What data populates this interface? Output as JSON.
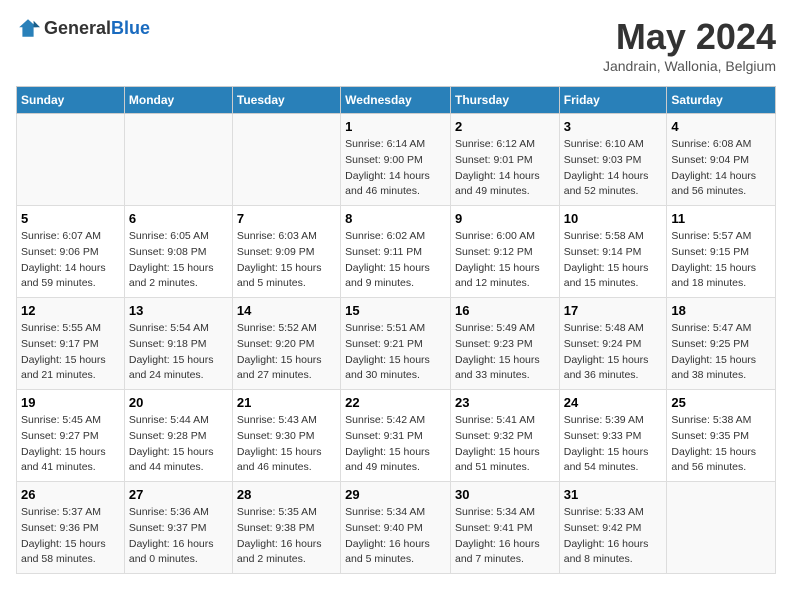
{
  "header": {
    "logo_general": "General",
    "logo_blue": "Blue",
    "month_title": "May 2024",
    "location": "Jandrain, Wallonia, Belgium"
  },
  "weekdays": [
    "Sunday",
    "Monday",
    "Tuesday",
    "Wednesday",
    "Thursday",
    "Friday",
    "Saturday"
  ],
  "weeks": [
    [
      {
        "day": "",
        "info": ""
      },
      {
        "day": "",
        "info": ""
      },
      {
        "day": "",
        "info": ""
      },
      {
        "day": "1",
        "info": "Sunrise: 6:14 AM\nSunset: 9:00 PM\nDaylight: 14 hours\nand 46 minutes."
      },
      {
        "day": "2",
        "info": "Sunrise: 6:12 AM\nSunset: 9:01 PM\nDaylight: 14 hours\nand 49 minutes."
      },
      {
        "day": "3",
        "info": "Sunrise: 6:10 AM\nSunset: 9:03 PM\nDaylight: 14 hours\nand 52 minutes."
      },
      {
        "day": "4",
        "info": "Sunrise: 6:08 AM\nSunset: 9:04 PM\nDaylight: 14 hours\nand 56 minutes."
      }
    ],
    [
      {
        "day": "5",
        "info": "Sunrise: 6:07 AM\nSunset: 9:06 PM\nDaylight: 14 hours\nand 59 minutes."
      },
      {
        "day": "6",
        "info": "Sunrise: 6:05 AM\nSunset: 9:08 PM\nDaylight: 15 hours\nand 2 minutes."
      },
      {
        "day": "7",
        "info": "Sunrise: 6:03 AM\nSunset: 9:09 PM\nDaylight: 15 hours\nand 5 minutes."
      },
      {
        "day": "8",
        "info": "Sunrise: 6:02 AM\nSunset: 9:11 PM\nDaylight: 15 hours\nand 9 minutes."
      },
      {
        "day": "9",
        "info": "Sunrise: 6:00 AM\nSunset: 9:12 PM\nDaylight: 15 hours\nand 12 minutes."
      },
      {
        "day": "10",
        "info": "Sunrise: 5:58 AM\nSunset: 9:14 PM\nDaylight: 15 hours\nand 15 minutes."
      },
      {
        "day": "11",
        "info": "Sunrise: 5:57 AM\nSunset: 9:15 PM\nDaylight: 15 hours\nand 18 minutes."
      }
    ],
    [
      {
        "day": "12",
        "info": "Sunrise: 5:55 AM\nSunset: 9:17 PM\nDaylight: 15 hours\nand 21 minutes."
      },
      {
        "day": "13",
        "info": "Sunrise: 5:54 AM\nSunset: 9:18 PM\nDaylight: 15 hours\nand 24 minutes."
      },
      {
        "day": "14",
        "info": "Sunrise: 5:52 AM\nSunset: 9:20 PM\nDaylight: 15 hours\nand 27 minutes."
      },
      {
        "day": "15",
        "info": "Sunrise: 5:51 AM\nSunset: 9:21 PM\nDaylight: 15 hours\nand 30 minutes."
      },
      {
        "day": "16",
        "info": "Sunrise: 5:49 AM\nSunset: 9:23 PM\nDaylight: 15 hours\nand 33 minutes."
      },
      {
        "day": "17",
        "info": "Sunrise: 5:48 AM\nSunset: 9:24 PM\nDaylight: 15 hours\nand 36 minutes."
      },
      {
        "day": "18",
        "info": "Sunrise: 5:47 AM\nSunset: 9:25 PM\nDaylight: 15 hours\nand 38 minutes."
      }
    ],
    [
      {
        "day": "19",
        "info": "Sunrise: 5:45 AM\nSunset: 9:27 PM\nDaylight: 15 hours\nand 41 minutes."
      },
      {
        "day": "20",
        "info": "Sunrise: 5:44 AM\nSunset: 9:28 PM\nDaylight: 15 hours\nand 44 minutes."
      },
      {
        "day": "21",
        "info": "Sunrise: 5:43 AM\nSunset: 9:30 PM\nDaylight: 15 hours\nand 46 minutes."
      },
      {
        "day": "22",
        "info": "Sunrise: 5:42 AM\nSunset: 9:31 PM\nDaylight: 15 hours\nand 49 minutes."
      },
      {
        "day": "23",
        "info": "Sunrise: 5:41 AM\nSunset: 9:32 PM\nDaylight: 15 hours\nand 51 minutes."
      },
      {
        "day": "24",
        "info": "Sunrise: 5:39 AM\nSunset: 9:33 PM\nDaylight: 15 hours\nand 54 minutes."
      },
      {
        "day": "25",
        "info": "Sunrise: 5:38 AM\nSunset: 9:35 PM\nDaylight: 15 hours\nand 56 minutes."
      }
    ],
    [
      {
        "day": "26",
        "info": "Sunrise: 5:37 AM\nSunset: 9:36 PM\nDaylight: 15 hours\nand 58 minutes."
      },
      {
        "day": "27",
        "info": "Sunrise: 5:36 AM\nSunset: 9:37 PM\nDaylight: 16 hours\nand 0 minutes."
      },
      {
        "day": "28",
        "info": "Sunrise: 5:35 AM\nSunset: 9:38 PM\nDaylight: 16 hours\nand 2 minutes."
      },
      {
        "day": "29",
        "info": "Sunrise: 5:34 AM\nSunset: 9:40 PM\nDaylight: 16 hours\nand 5 minutes."
      },
      {
        "day": "30",
        "info": "Sunrise: 5:34 AM\nSunset: 9:41 PM\nDaylight: 16 hours\nand 7 minutes."
      },
      {
        "day": "31",
        "info": "Sunrise: 5:33 AM\nSunset: 9:42 PM\nDaylight: 16 hours\nand 8 minutes."
      },
      {
        "day": "",
        "info": ""
      }
    ]
  ]
}
